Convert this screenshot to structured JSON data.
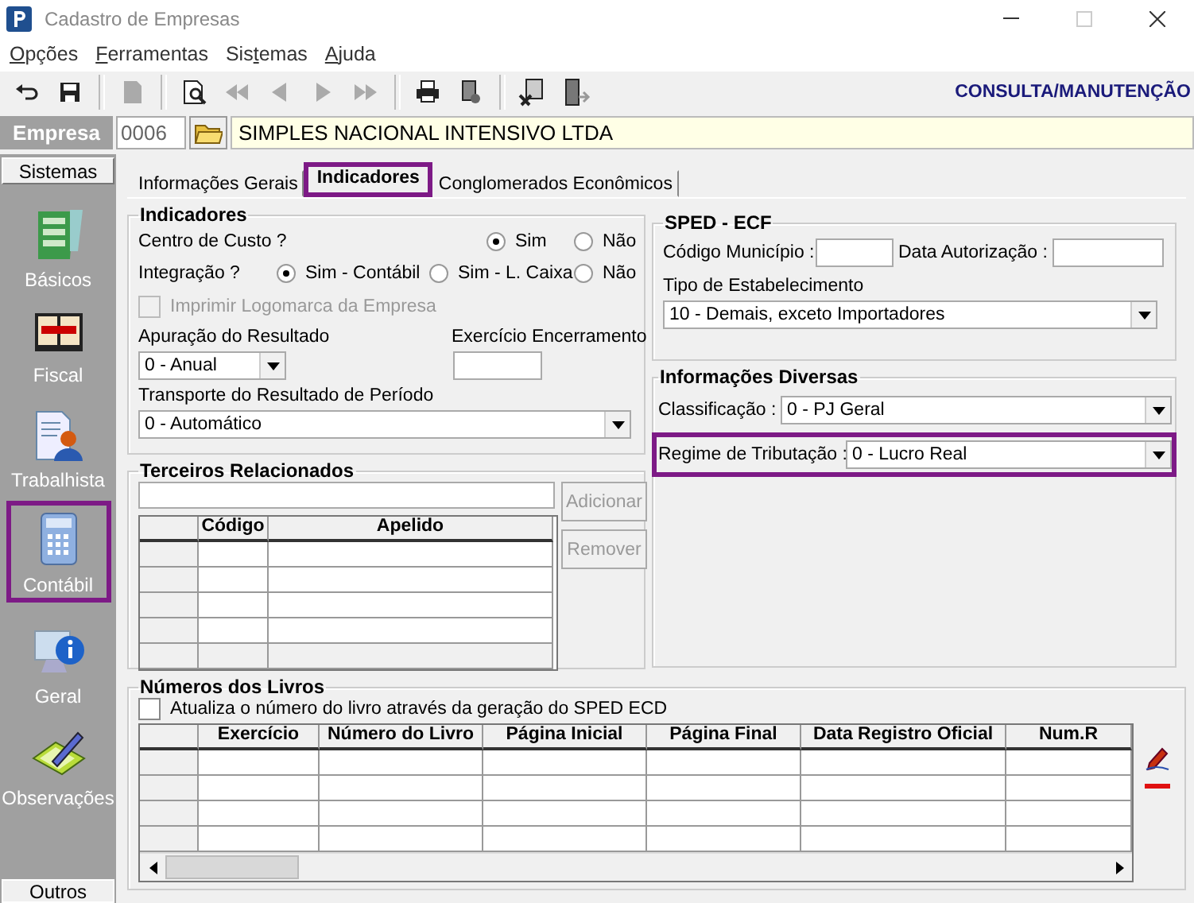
{
  "window": {
    "title": "Cadastro de Empresas"
  },
  "menu": [
    {
      "key": "O",
      "after": "pções"
    },
    {
      "key": "F",
      "after": "erramentas"
    },
    {
      "before": "Sis",
      "key": "t",
      "after": "emas"
    },
    {
      "key": "A",
      "after": "juda"
    }
  ],
  "toolbar": {
    "buttons": [
      {
        "kind": "undo",
        "disabled": false
      },
      {
        "kind": "save",
        "disabled": false
      },
      {
        "kind": "page",
        "disabled": true
      },
      {
        "kind": "preview",
        "disabled": false
      },
      {
        "kind": "first",
        "disabled": true
      },
      {
        "kind": "prev",
        "disabled": true
      },
      {
        "kind": "next",
        "disabled": true
      },
      {
        "kind": "last",
        "disabled": true
      },
      {
        "kind": "print",
        "disabled": false
      },
      {
        "kind": "report",
        "disabled": false
      },
      {
        "kind": "tools",
        "disabled": false
      },
      {
        "kind": "exit",
        "disabled": false
      }
    ],
    "mode": "CONSULTA/MANUTENÇÃO"
  },
  "empresa": {
    "label": "Empresa",
    "code": "0006",
    "name": "SIMPLES NACIONAL INTENSIVO LTDA"
  },
  "sidebar": {
    "header": "Sistemas",
    "footer": "Outros",
    "items": [
      {
        "kind": "basicos",
        "label": "Básicos",
        "highlighted": false
      },
      {
        "kind": "fiscal",
        "label": "Fiscal",
        "highlighted": false
      },
      {
        "kind": "trabalhista",
        "label": "Trabalhista",
        "highlighted": false
      },
      {
        "kind": "contabil",
        "label": "Contábil",
        "highlighted": true
      },
      {
        "kind": "geral",
        "label": "Geral",
        "highlighted": false
      },
      {
        "kind": "observacoes",
        "label": "Observações",
        "highlighted": false
      }
    ]
  },
  "tabs": [
    {
      "label": "Informações Gerais",
      "selected": false,
      "highlighted": false
    },
    {
      "label": "Indicadores",
      "selected": true,
      "highlighted": true
    },
    {
      "label": "Conglomerados Econômicos",
      "selected": false,
      "highlighted": false
    }
  ],
  "indicadores": {
    "title": "Indicadores",
    "centro_custo": {
      "label": "Centro de Custo ?",
      "options": [
        {
          "label": "Sim",
          "selected": true
        },
        {
          "label": "Não",
          "selected": false
        }
      ]
    },
    "integracao": {
      "label": "Integração ?",
      "options": [
        {
          "label": "Sim - Contábil",
          "selected": true
        },
        {
          "label": "Sim - L. Caixa",
          "selected": false
        },
        {
          "label": "Não",
          "selected": false
        }
      ]
    },
    "logomarca": {
      "label": "Imprimir Logomarca da Empresa",
      "checked": false,
      "disabled": true
    },
    "apuracao": {
      "label": "Apuração do Resultado",
      "value": "0 - Anual"
    },
    "exercicio": {
      "label": "Exercício Encerramento"
    },
    "transporte": {
      "label": "Transporte do Resultado de Período",
      "value": "0 - Automático"
    }
  },
  "terceiros": {
    "title": "Terceiros Relacionados",
    "columns": [
      "Código",
      "Apelido"
    ],
    "buttons": [
      {
        "label": "Adicionar",
        "disabled": true
      },
      {
        "label": "Remover",
        "disabled": true
      }
    ]
  },
  "sped": {
    "title": "SPED - ECF",
    "codigo_municipio": {
      "label": "Código Município :"
    },
    "data_autorizacao": {
      "label": "Data Autorização :"
    },
    "tipo": {
      "label": "Tipo de Estabelecimento",
      "value": "10 - Demais, exceto Importadores"
    }
  },
  "diversas": {
    "title": "Informações Diversas",
    "classificacao": {
      "label": "Classificação :",
      "value": "0 - PJ Geral",
      "highlighted": false
    },
    "regime": {
      "label": "Regime de Tributação :",
      "value": "0 - Lucro Real",
      "highlighted": true
    }
  },
  "livros": {
    "title": "Números dos Livros",
    "atualiza": {
      "label": "Atualiza o número do livro através da geração do SPED ECD",
      "checked": false
    },
    "columns": [
      "Exercício",
      "Número do Livro",
      "Página Inicial",
      "Página Final",
      "Data Registro Oficial",
      "Num.R"
    ]
  }
}
